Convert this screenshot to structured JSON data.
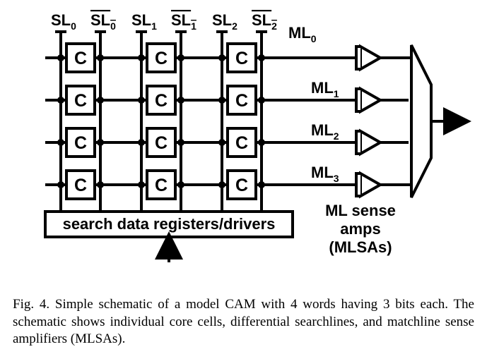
{
  "sl_labels": [
    "SL",
    "SL",
    "SL",
    "SL",
    "SL",
    "SL"
  ],
  "sl_subs": [
    "0",
    "0",
    "1",
    "1",
    "2",
    "2"
  ],
  "ml_labels": [
    "ML",
    "ML",
    "ML",
    "ML"
  ],
  "ml_subs": [
    "0",
    "1",
    "2",
    "3"
  ],
  "cell": "C",
  "drivers": "search data registers/drivers",
  "mlsa1": "ML sense",
  "mlsa2": "amps",
  "mlsa3": "(MLSAs)",
  "caption": "Fig. 4.   Simple schematic of a model CAM with 4 words having 3 bits each. The schematic shows individual core cells, differential searchlines, and matchline sense amplifiers (MLSAs)."
}
